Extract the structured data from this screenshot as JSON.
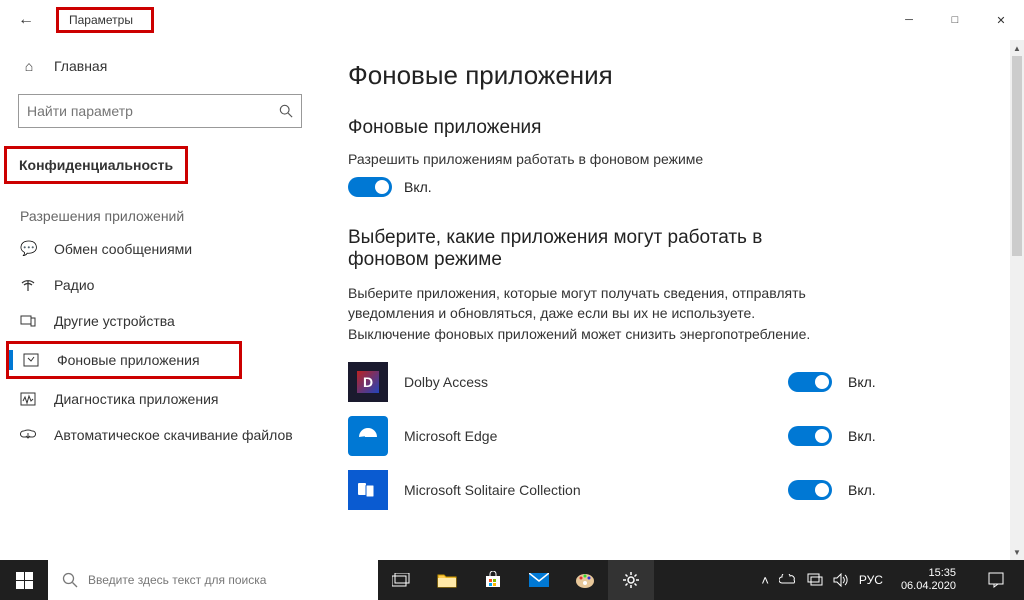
{
  "titlebar": {
    "title": "Параметры"
  },
  "sidebar": {
    "home": "Главная",
    "search_placeholder": "Найти параметр",
    "category": "Конфиденциальность",
    "perms_heading": "Разрешения приложений",
    "items": [
      {
        "icon": "chat",
        "label": "Обмен сообщениями"
      },
      {
        "icon": "radio",
        "label": "Радио"
      },
      {
        "icon": "devices",
        "label": "Другие устройства"
      },
      {
        "icon": "bgapps",
        "label": "Фоновые приложения"
      },
      {
        "icon": "diag",
        "label": "Диагностика приложения"
      },
      {
        "icon": "download",
        "label": "Автоматическое скачивание файлов"
      }
    ]
  },
  "content": {
    "page_title": "Фоновые приложения",
    "section1_title": "Фоновые приложения",
    "section1_sub": "Разрешить приложениям работать в фоновом режиме",
    "toggle_on_label": "Вкл.",
    "section2_title": "Выберите, какие приложения могут работать в фоновом режиме",
    "section2_desc": "Выберите приложения, которые могут получать сведения, отправлять уведомления и обновляться, даже если вы их не используете. Выключение фоновых приложений может снизить энергопотребление.",
    "apps": [
      {
        "name": "Dolby Access",
        "state": "Вкл."
      },
      {
        "name": "Microsoft Edge",
        "state": "Вкл."
      },
      {
        "name": "Microsoft Solitaire Collection",
        "state": "Вкл."
      }
    ]
  },
  "taskbar": {
    "search_placeholder": "Введите здесь текст для поиска",
    "lang": "РУС",
    "time": "15:35",
    "date": "06.04.2020"
  }
}
